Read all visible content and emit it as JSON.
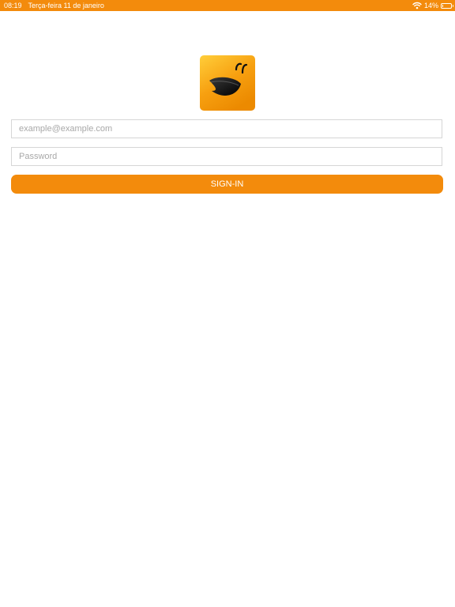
{
  "status_bar": {
    "time": "08:19",
    "date": "Terça-feira 11 de janeiro",
    "battery": "14%",
    "battery_level": 0.14,
    "wifi_icon": "wifi-icon",
    "battery_icon": "battery-icon"
  },
  "app": {
    "logo_icon": "app-logo-icon",
    "brand_color": "#f38b0c"
  },
  "login": {
    "email_placeholder": "example@example.com",
    "email_value": "",
    "password_placeholder": "Password",
    "password_value": "",
    "signin_label": "SIGN-IN"
  }
}
